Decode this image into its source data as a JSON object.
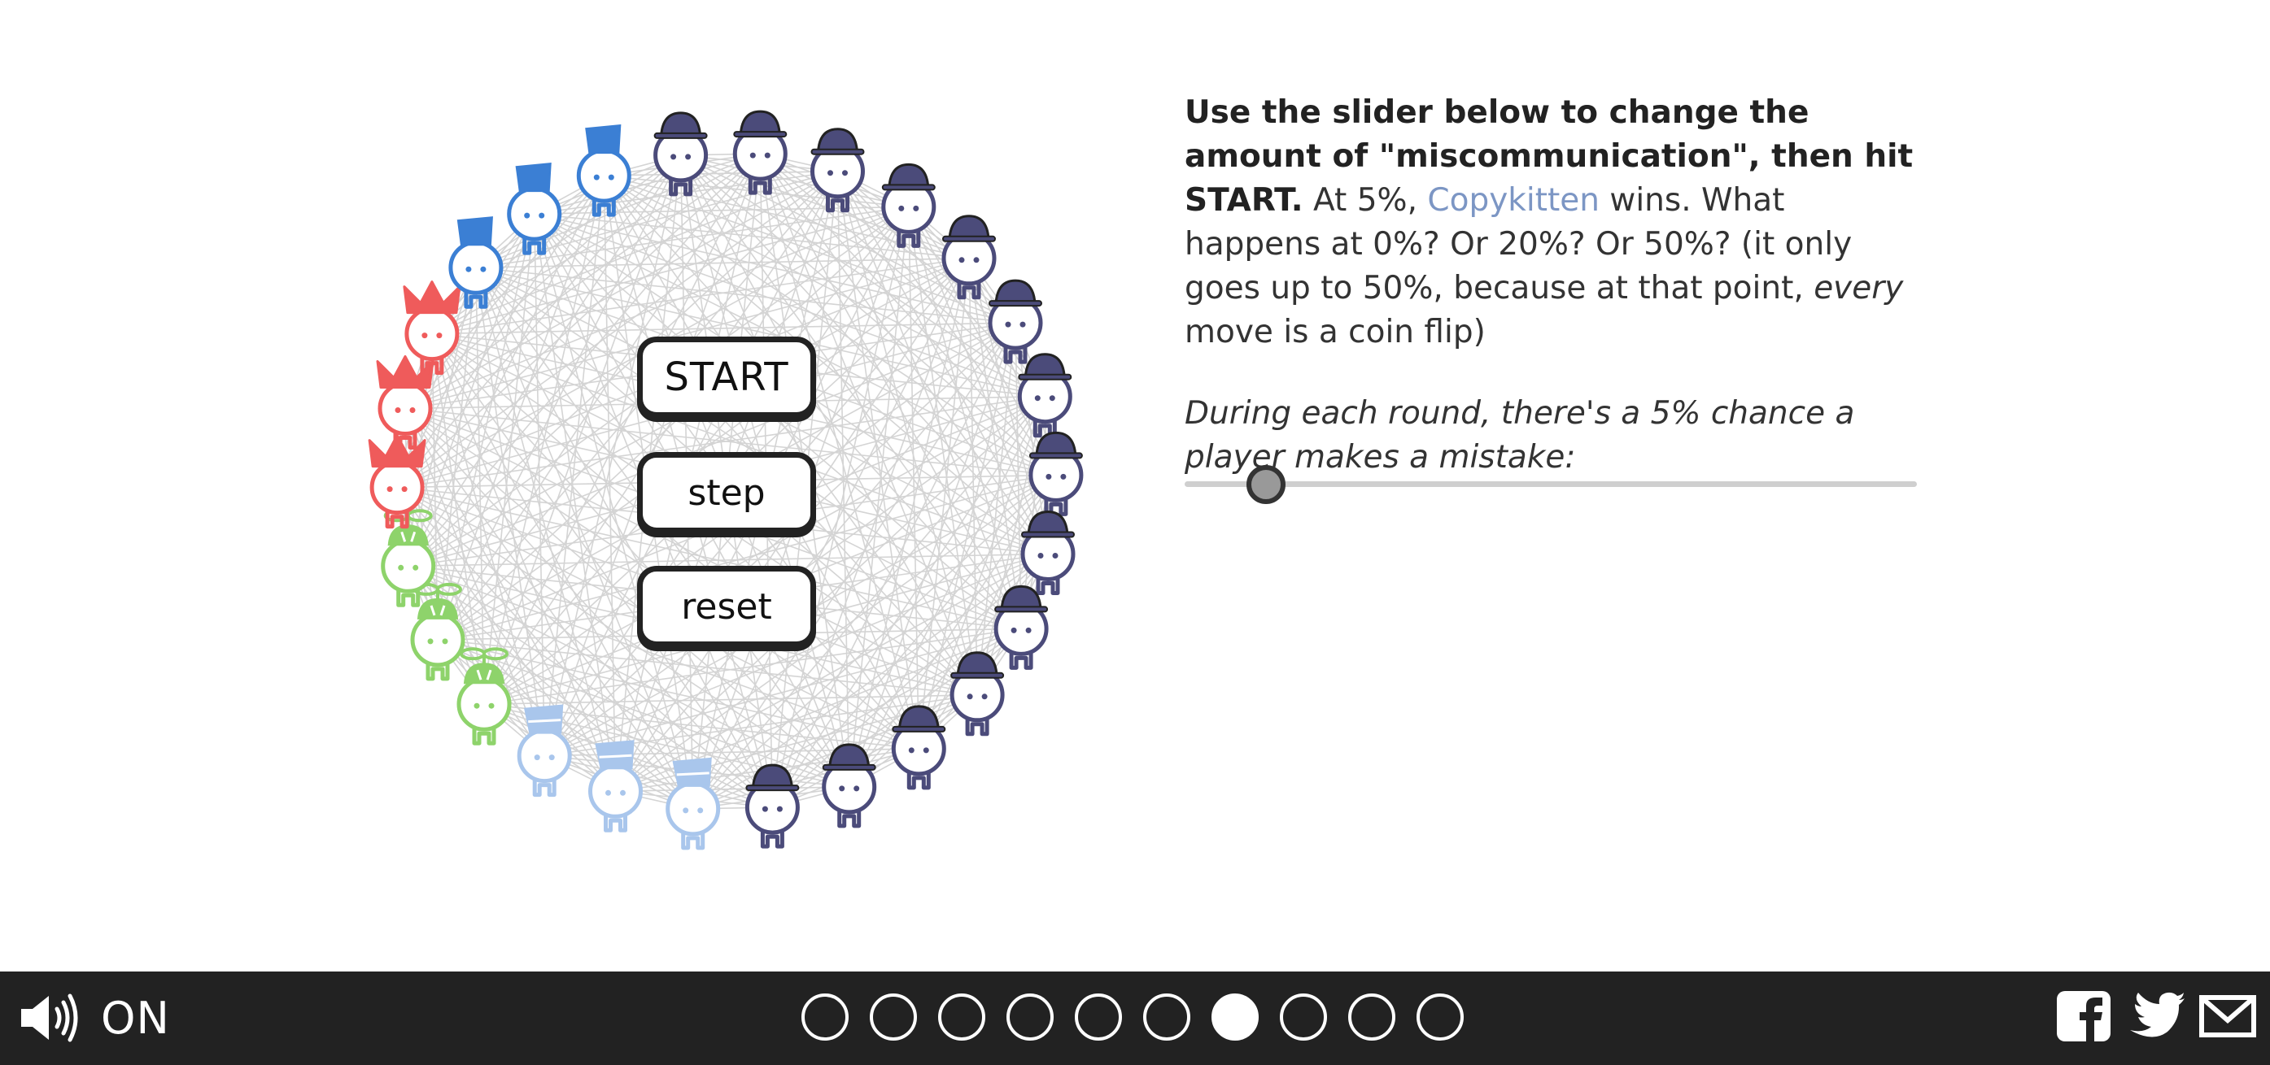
{
  "sim": {
    "buttons": {
      "start": "START",
      "step": "step",
      "reset": "reset"
    },
    "players": [
      {
        "strategy": "copycat",
        "hat": "bowler",
        "color": "#4b4b7a"
      },
      {
        "strategy": "copycat",
        "hat": "bowler",
        "color": "#4b4b7a"
      },
      {
        "strategy": "copycat",
        "hat": "bowler",
        "color": "#4b4b7a"
      },
      {
        "strategy": "copycat",
        "hat": "bowler",
        "color": "#4b4b7a"
      },
      {
        "strategy": "copycat",
        "hat": "bowler",
        "color": "#4b4b7a"
      },
      {
        "strategy": "copycat",
        "hat": "bowler",
        "color": "#4b4b7a"
      },
      {
        "strategy": "copycat",
        "hat": "bowler",
        "color": "#4b4b7a"
      },
      {
        "strategy": "copycat",
        "hat": "bowler",
        "color": "#4b4b7a"
      },
      {
        "strategy": "copycat",
        "hat": "bowler",
        "color": "#4b4b7a"
      },
      {
        "strategy": "copycat",
        "hat": "bowler",
        "color": "#4b4b7a"
      },
      {
        "strategy": "copycat",
        "hat": "bowler",
        "color": "#4b4b7a"
      },
      {
        "strategy": "copycat",
        "hat": "bowler",
        "color": "#4b4b7a"
      },
      {
        "strategy": "copycat",
        "hat": "bowler",
        "color": "#4b4b7a"
      },
      {
        "strategy": "copycat",
        "hat": "bowler",
        "color": "#4b4b7a"
      },
      {
        "strategy": "copykitten",
        "hat": "bucket",
        "color": "#a9c6ec"
      },
      {
        "strategy": "copykitten",
        "hat": "bucket",
        "color": "#a9c6ec"
      },
      {
        "strategy": "copykitten",
        "hat": "bucket",
        "color": "#a9c6ec"
      },
      {
        "strategy": "simpleton",
        "hat": "propeller",
        "color": "#8ed36b"
      },
      {
        "strategy": "simpleton",
        "hat": "propeller",
        "color": "#8ed36b"
      },
      {
        "strategy": "simpleton",
        "hat": "propeller",
        "color": "#8ed36b"
      },
      {
        "strategy": "random",
        "hat": "jester",
        "color": "#ef5b5b"
      },
      {
        "strategy": "random",
        "hat": "jester",
        "color": "#ef5b5b"
      },
      {
        "strategy": "random",
        "hat": "jester",
        "color": "#ef5b5b"
      },
      {
        "strategy": "grudger",
        "hat": "fez",
        "color": "#3b7fd4"
      },
      {
        "strategy": "grudger",
        "hat": "fez",
        "color": "#3b7fd4"
      },
      {
        "strategy": "grudger",
        "hat": "fez",
        "color": "#3b7fd4"
      }
    ],
    "line_color": "#d4d4d4"
  },
  "text": {
    "intro_bold": "Use the slider below to change the amount of \"miscommunication\", then hit START.",
    "intro_a": " At 5%, ",
    "copykitten": "Copykitten",
    "intro_b": " wins. What happens at 0%? Or 20%? Or 50%? (it only goes up to 50%, because at that point, ",
    "every": "every",
    "intro_c": " move is a coin flip)",
    "slider_caption": "During each round, there's a 5% chance a player makes a mistake:",
    "link_color": "#7c96c4"
  },
  "slider": {
    "value_percent": 5,
    "max_percent": 50
  },
  "footer": {
    "sound_label": "ON",
    "pages": 10,
    "current_page": 7,
    "social_icons": [
      "facebook-icon",
      "twitter-icon",
      "email-icon"
    ]
  }
}
